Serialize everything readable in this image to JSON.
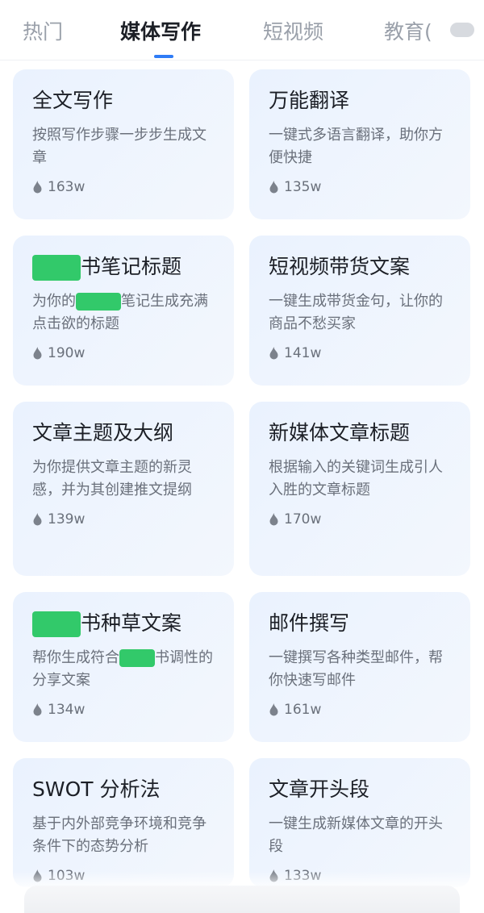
{
  "tabs": [
    {
      "label": "热门",
      "active": false
    },
    {
      "label": "媒体写作",
      "active": true
    },
    {
      "label": "短视频",
      "active": false
    },
    {
      "label": "教育(",
      "active": false
    }
  ],
  "cards": [
    {
      "title": "全文写作",
      "desc": "按照写作步骤一步步生成文章",
      "count": "163w"
    },
    {
      "title": "万能翻译",
      "desc": "一键式多语言翻译，助你方便快捷",
      "count": "135w"
    },
    {
      "title_suffix": "书笔记标题",
      "desc_prefix": "为你的",
      "desc_suffix": "笔记生成充满点击欲的标题",
      "count": "190w"
    },
    {
      "title": "短视频带货文案",
      "desc": "一键生成带货金句，让你的商品不愁买家",
      "count": "141w"
    },
    {
      "title": "文章主题及大纲",
      "desc": "为你提供文章主题的新灵感，并为其创建推文提纲",
      "count": "139w"
    },
    {
      "title": "新媒体文章标题",
      "desc": "根据输入的关键词生成引人入胜的文章标题",
      "count": "170w"
    },
    {
      "title_suffix": "书种草文案",
      "desc_prefix": "帮你生成符合",
      "desc_suffix": "书调性的分享文案",
      "count": "134w"
    },
    {
      "title": "邮件撰写",
      "desc": "一键撰写各种类型邮件，帮你快速写邮件",
      "count": "161w"
    },
    {
      "title": "SWOT 分析法",
      "desc": "基于内外部竞争环境和竞争条件下的态势分析",
      "count": "103w"
    },
    {
      "title": "文章开头段",
      "desc": "一键生成新媒体文章的开头段",
      "count": "133w"
    }
  ],
  "colors": {
    "accent": "#2f7cf6",
    "card_bg": "#eaf2fe",
    "redaction": "#32c96a"
  }
}
